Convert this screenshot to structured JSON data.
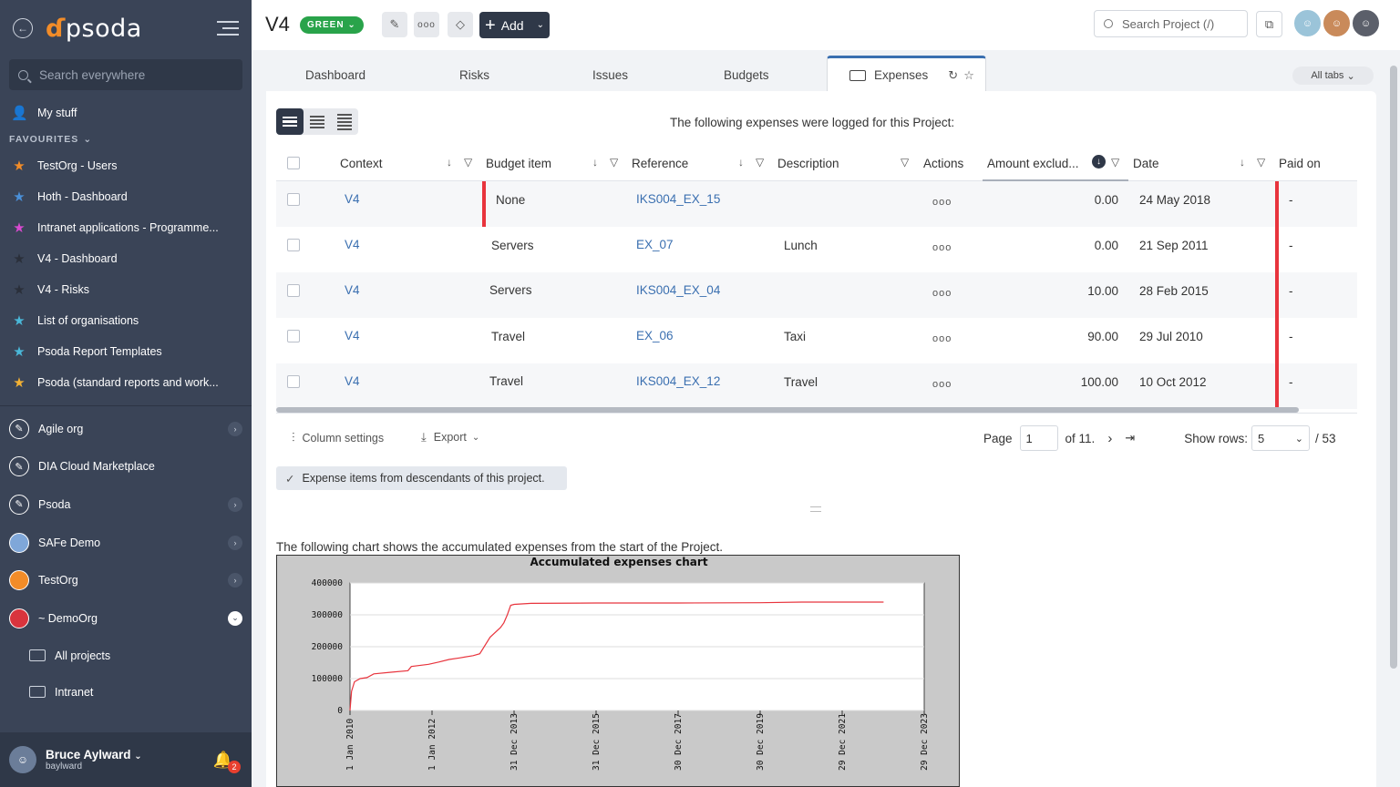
{
  "sidebar": {
    "logo": "psoda",
    "search_placeholder": "Search everywhere",
    "my_stuff": "My stuff",
    "favourites_label": "FAVOURITES",
    "favourites": [
      {
        "label": "TestOrg - Users",
        "color": "#f28c28"
      },
      {
        "label": "Hoth - Dashboard",
        "color": "#4a90d9"
      },
      {
        "label": "Intranet applications - Programme...",
        "color": "#d94ad0"
      },
      {
        "label": "V4 - Dashboard",
        "color": "#2a2f3a"
      },
      {
        "label": "V4 - Risks",
        "color": "#2a2f3a"
      },
      {
        "label": "List of organisations",
        "color": "#4ab8d9"
      },
      {
        "label": "Psoda Report Templates",
        "color": "#4ab8d9"
      },
      {
        "label": "Psoda (standard reports and work...",
        "color": "#f2b134"
      }
    ],
    "orgs": [
      {
        "label": "Agile org",
        "icon_color": "#3a4457",
        "expandable": true,
        "open": false
      },
      {
        "label": "DIA Cloud Marketplace",
        "icon_color": "#3a4457",
        "expandable": false,
        "open": false
      },
      {
        "label": "Psoda",
        "icon_color": "#3a4457",
        "expandable": true,
        "open": false
      },
      {
        "label": "SAFe Demo",
        "icon_color": "#7fa7d9",
        "expandable": true,
        "open": false
      },
      {
        "label": "TestOrg",
        "icon_color": "#f28c28",
        "expandable": true,
        "open": false
      },
      {
        "label": "~ DemoOrg",
        "icon_color": "#d9343d",
        "expandable": true,
        "open": true
      }
    ],
    "sub_items": [
      "All projects",
      "Intranet"
    ],
    "user": {
      "name": "Bruce Aylward",
      "login": "baylward",
      "notifications": "2"
    }
  },
  "topbar": {
    "title": "V4",
    "status": "GREEN",
    "add_label": "Add",
    "search_placeholder": "Search Project (/)"
  },
  "tabs": {
    "items": [
      "Dashboard",
      "Risks",
      "Issues",
      "Budgets"
    ],
    "active": "Expenses",
    "all_tabs": "All tabs"
  },
  "main": {
    "intro": "The following expenses were logged for this Project:",
    "columns": [
      "Context",
      "Budget item",
      "Reference",
      "Description",
      "Actions",
      "Amount exclud...",
      "Date",
      "Paid on"
    ],
    "rows": [
      {
        "context": "V4",
        "budget_item": "None",
        "reference": "IKS004_EX_15",
        "description": "",
        "amount": "0.00",
        "date": "24 May 2018",
        "paid_on": "-"
      },
      {
        "context": "V4",
        "budget_item": "Servers",
        "reference": "EX_07",
        "description": "Lunch",
        "amount": "0.00",
        "date": "21 Sep 2011",
        "paid_on": "-"
      },
      {
        "context": "V4",
        "budget_item": "Servers",
        "reference": "IKS004_EX_04",
        "description": "",
        "amount": "10.00",
        "date": "28 Feb 2015",
        "paid_on": "-"
      },
      {
        "context": "V4",
        "budget_item": "Travel",
        "reference": "EX_06",
        "description": "Taxi",
        "amount": "90.00",
        "date": "29 Jul 2010",
        "paid_on": "-"
      },
      {
        "context": "V4",
        "budget_item": "Travel",
        "reference": "IKS004_EX_12",
        "description": "Travel",
        "amount": "100.00",
        "date": "10 Oct 2012",
        "paid_on": "-"
      }
    ],
    "column_settings": "Column settings",
    "export": "Export",
    "page_label": "Page",
    "page_value": "1",
    "page_of": "of 11.",
    "show_rows_label": "Show rows:",
    "show_rows_value": "5",
    "total": "/ 53",
    "descendants_chip": "Expense items from descendants of this project.",
    "chart_intro": "The following chart shows the accumulated expenses from the start of the Project."
  },
  "chart_data": {
    "type": "line",
    "title": "Accumulated expenses chart",
    "xlabel": "",
    "ylabel": "",
    "ylim": [
      0,
      400000
    ],
    "yticks": [
      0,
      100000,
      200000,
      300000,
      400000
    ],
    "xticks": [
      "1 Jan 2010",
      "1 Jan 2012",
      "31 Dec 2013",
      "31 Dec 2015",
      "30 Dec 2017",
      "30 Dec 2019",
      "29 Dec 2021",
      "29 Dec 2023"
    ],
    "series": [
      {
        "color": "#e8343d",
        "x": [
          "2010-01-01",
          "2010-01-15",
          "2010-02-10",
          "2010-04-01",
          "2010-06-01",
          "2010-08-01",
          "2011-01-01",
          "2011-06-01",
          "2011-07-01",
          "2011-12-01",
          "2012-03-01",
          "2012-06-01",
          "2012-09-01",
          "2013-01-01",
          "2013-03-01",
          "2013-06-01",
          "2013-09-01",
          "2013-10-01",
          "2013-11-01",
          "2013-12-01",
          "2014-01-01",
          "2014-06-01",
          "2016-01-01",
          "2018-01-01",
          "2020-01-01",
          "2021-01-01",
          "2023-01-01"
        ],
        "y": [
          0,
          60000,
          90000,
          100000,
          103000,
          115000,
          120000,
          125000,
          138000,
          145000,
          152000,
          160000,
          165000,
          172000,
          178000,
          230000,
          260000,
          275000,
          300000,
          330000,
          333000,
          336000,
          337000,
          337000,
          338000,
          340000,
          340000
        ]
      }
    ]
  }
}
